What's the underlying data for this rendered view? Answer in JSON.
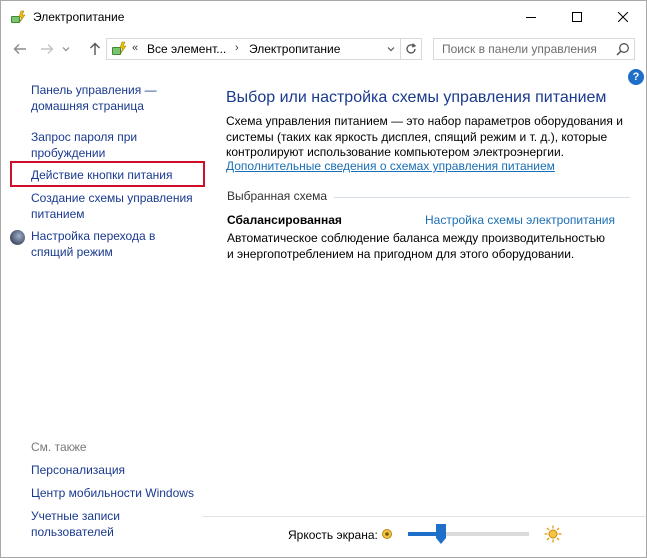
{
  "window": {
    "title": "Электропитание",
    "icon": "power-options-icon"
  },
  "nav": {
    "breadcrumb_overflow": "«",
    "breadcrumb_1": "Все элемент...",
    "breadcrumb_sep": "›",
    "breadcrumb_2": "Электропитание",
    "search_placeholder": "Поиск в панели управления"
  },
  "help": {
    "label": "?"
  },
  "sidebar": {
    "items": [
      {
        "line1": "Панель управления —",
        "line2": "домашняя страница"
      },
      {
        "line1": "Запрос пароля при",
        "line2": "пробуждении"
      },
      {
        "line1": "Действие кнопки питания"
      },
      {
        "line1": "Создание схемы управления",
        "line2": "питанием"
      },
      {
        "line1": "Настройка перехода в",
        "line2": "спящий режим"
      }
    ],
    "see_also_title": "См. также",
    "see_also": [
      {
        "line1": "Персонализация"
      },
      {
        "line1": "Центр мобильности Windows"
      },
      {
        "line1": "Учетные записи",
        "line2": "пользователей"
      }
    ]
  },
  "main": {
    "heading": "Выбор или настройка схемы управления питанием",
    "description_1": "Схема управления питанием — это набор параметров оборудования и",
    "description_2": "системы (таких как яркость дисплея, спящий режим и т. д.), которые",
    "description_3": "контролируют использование компьютером электроэнергии.",
    "more_info_link": "Дополнительные сведения о схемах управления питанием",
    "selected_plan_label": "Выбранная схема",
    "plan_name": "Сбалансированная",
    "plan_settings_link": "Настройка схемы электропитания",
    "plan_description_1": "Автоматическое соблюдение баланса между производительностью",
    "plan_description_2": "и энергопотреблением на пригодном для этого оборудовании."
  },
  "brightness": {
    "label": "Яркость экрана:",
    "value_fraction": 0.27
  },
  "colors": {
    "link": "#1a3a8f",
    "accent": "#1e6fc9",
    "highlight": "#d0102b"
  }
}
